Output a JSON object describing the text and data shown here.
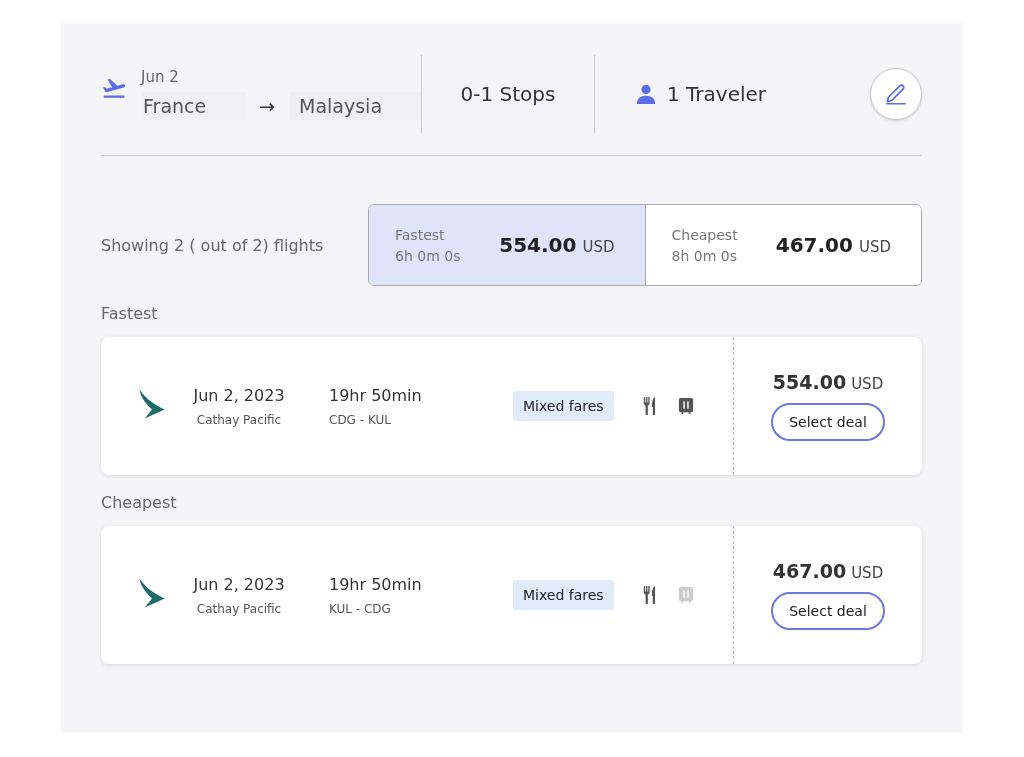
{
  "search": {
    "date": "Jun 2",
    "origin": "France",
    "arrow": "→",
    "destination": "Malaysia",
    "stops": "0-1 Stops",
    "travelers": "1 Traveler"
  },
  "summary": {
    "text": "Showing 2 ( out of 2) flights",
    "options": [
      {
        "label": "Fastest",
        "duration": "6h 0m 0s",
        "price": "554.00",
        "currency": "USD",
        "selected": true
      },
      {
        "label": "Cheapest",
        "duration": "8h 0m 0s",
        "price": "467.00",
        "currency": "USD",
        "selected": false
      }
    ]
  },
  "groups": [
    {
      "heading": "Fastest",
      "flight": {
        "date": "Jun 2, 2023",
        "airline": "Cathay Pacific",
        "duration": "19hr 50min",
        "route": "CDG - KUL",
        "fare": "Mixed fares",
        "meal_included": true,
        "baggage_included": true,
        "price": "554.00",
        "currency": "USD",
        "button": "Select deal"
      }
    },
    {
      "heading": "Cheapest",
      "flight": {
        "date": "Jun 2, 2023",
        "airline": "Cathay Pacific",
        "duration": "19hr 50min",
        "route": "KUL - CDG",
        "fare": "Mixed fares",
        "meal_included": true,
        "baggage_included": false,
        "price": "467.00",
        "currency": "USD",
        "button": "Select deal"
      }
    }
  ]
}
